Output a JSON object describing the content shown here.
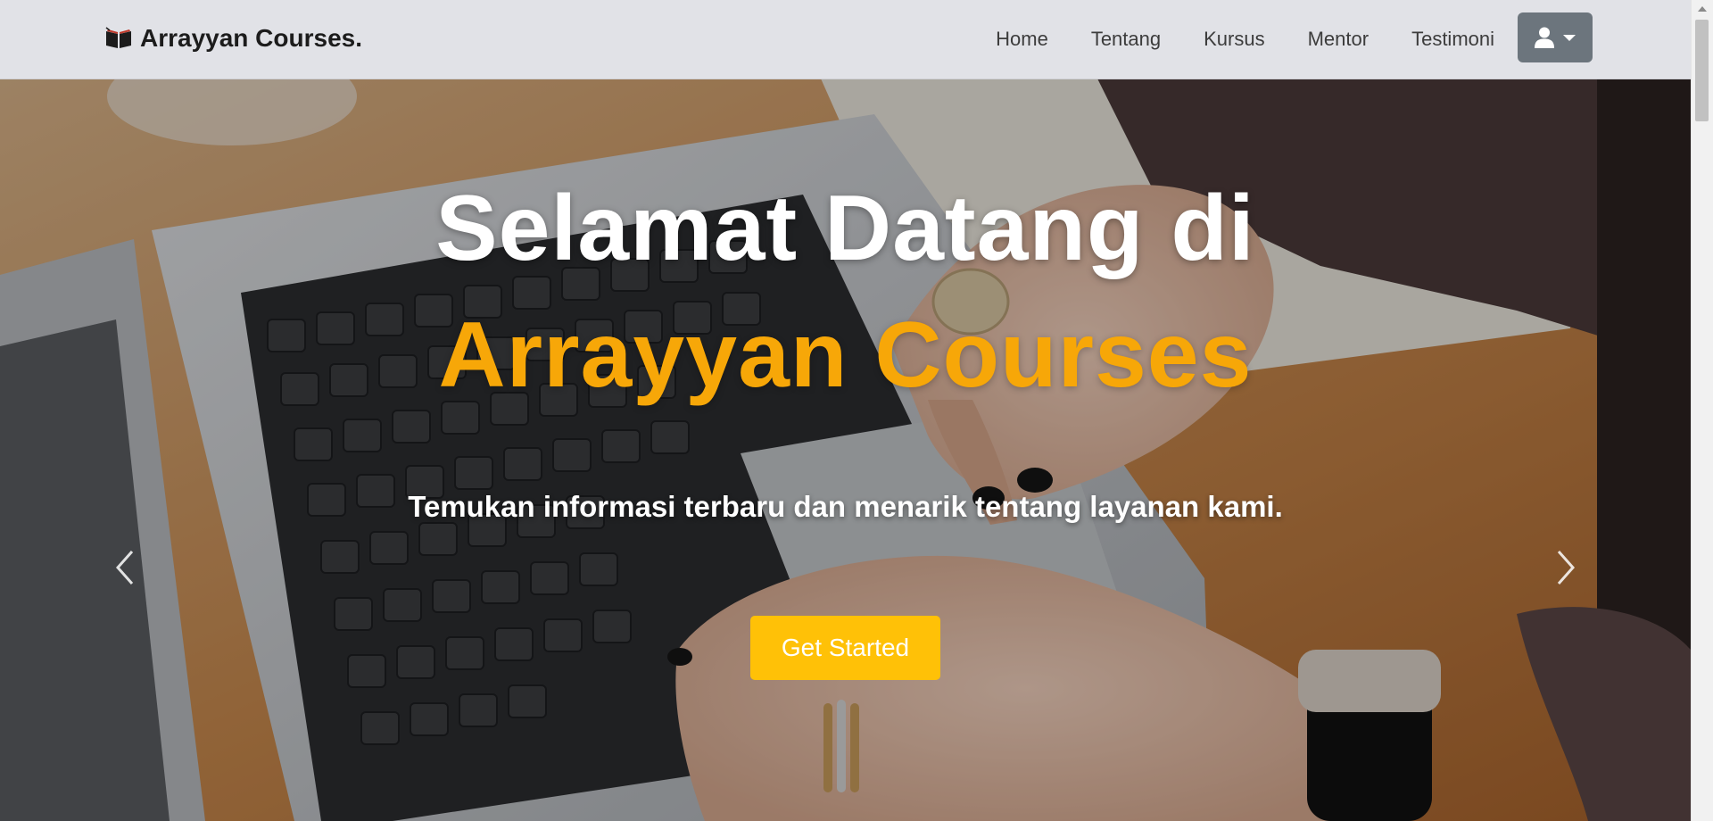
{
  "navbar": {
    "brand": "Arrayyan Courses.",
    "brand_icon": "open-book-icon",
    "links": [
      {
        "label": "Home"
      },
      {
        "label": "Tentang"
      },
      {
        "label": "Kursus"
      },
      {
        "label": "Mentor"
      },
      {
        "label": "Testimoni"
      }
    ],
    "user_menu_icon": "user-icon"
  },
  "hero": {
    "title_line1": "Selamat Datang di",
    "title_line2": "Arrayyan Courses",
    "subtitle": "Temukan informasi terbaru dan menarik tentang layanan kami.",
    "cta_label": "Get Started",
    "prev_icon": "chevron-left-icon",
    "next_icon": "chevron-right-icon"
  },
  "colors": {
    "navbar_bg": "#e1e2e7",
    "accent": "#f7a708",
    "cta_bg": "#ffc107",
    "user_button_bg": "#6c757d"
  }
}
